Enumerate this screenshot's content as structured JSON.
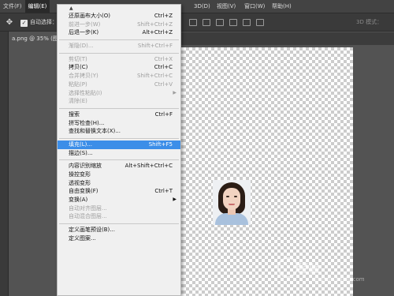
{
  "menubar": {
    "items": [
      {
        "label": "文件(F)"
      },
      {
        "label": "编辑(E)"
      },
      {
        "label": "3D(D)"
      },
      {
        "label": "视图(V)"
      },
      {
        "label": "窗口(W)"
      },
      {
        "label": "帮助(H)"
      }
    ]
  },
  "options": {
    "auto_select_label": "自动选择：",
    "mode_3d_label": "3D 模式："
  },
  "document": {
    "tab_label": "a.png @ 35% (图"
  },
  "edit_menu": {
    "items": [
      {
        "label": "还原画布大小(O)",
        "shortcut": "Ctrl+Z",
        "disabled": false
      },
      {
        "label": "前进一步(W)",
        "shortcut": "Shift+Ctrl+Z",
        "disabled": true
      },
      {
        "label": "后退一步(K)",
        "shortcut": "Alt+Ctrl+Z",
        "disabled": false
      },
      {
        "sep": true
      },
      {
        "label": "渐隐(D)...",
        "shortcut": "Shift+Ctrl+F",
        "disabled": true
      },
      {
        "sep": true
      },
      {
        "label": "剪切(T)",
        "shortcut": "Ctrl+X",
        "disabled": true
      },
      {
        "label": "拷贝(C)",
        "shortcut": "Ctrl+C",
        "disabled": false
      },
      {
        "label": "合并拷贝(Y)",
        "shortcut": "Shift+Ctrl+C",
        "disabled": true
      },
      {
        "label": "粘贴(P)",
        "shortcut": "Ctrl+V",
        "disabled": true
      },
      {
        "label": "选择性粘贴(I)",
        "shortcut": "",
        "disabled": true,
        "submenu": true
      },
      {
        "label": "清除(E)",
        "shortcut": "",
        "disabled": true
      },
      {
        "sep": true
      },
      {
        "label": "搜索",
        "shortcut": "Ctrl+F",
        "disabled": false
      },
      {
        "label": "拼写检查(H)...",
        "shortcut": "",
        "disabled": false
      },
      {
        "label": "查找和替换文本(X)...",
        "shortcut": "",
        "disabled": false
      },
      {
        "sep": true
      },
      {
        "label": "填充(L)...",
        "shortcut": "Shift+F5",
        "disabled": false,
        "highlight": true
      },
      {
        "label": "描边(S)...",
        "shortcut": "",
        "disabled": false
      },
      {
        "sep": true
      },
      {
        "label": "内容识别缩放",
        "shortcut": "Alt+Shift+Ctrl+C",
        "disabled": false
      },
      {
        "label": "操控变形",
        "shortcut": "",
        "disabled": false
      },
      {
        "label": "透视变形",
        "shortcut": "",
        "disabled": false
      },
      {
        "label": "自由变换(F)",
        "shortcut": "Ctrl+T",
        "disabled": false
      },
      {
        "label": "变换(A)",
        "shortcut": "",
        "disabled": false,
        "submenu": true
      },
      {
        "label": "自动对齐图层...",
        "shortcut": "",
        "disabled": true
      },
      {
        "label": "自动混合图层...",
        "shortcut": "",
        "disabled": true
      },
      {
        "sep": true
      },
      {
        "label": "定义画笔预设(B)...",
        "shortcut": "",
        "disabled": false
      },
      {
        "label": "定义图案...",
        "shortcut": "",
        "disabled": false
      }
    ]
  },
  "watermark": {
    "text": "经验",
    "sub": "jingyan.baidu.com"
  }
}
